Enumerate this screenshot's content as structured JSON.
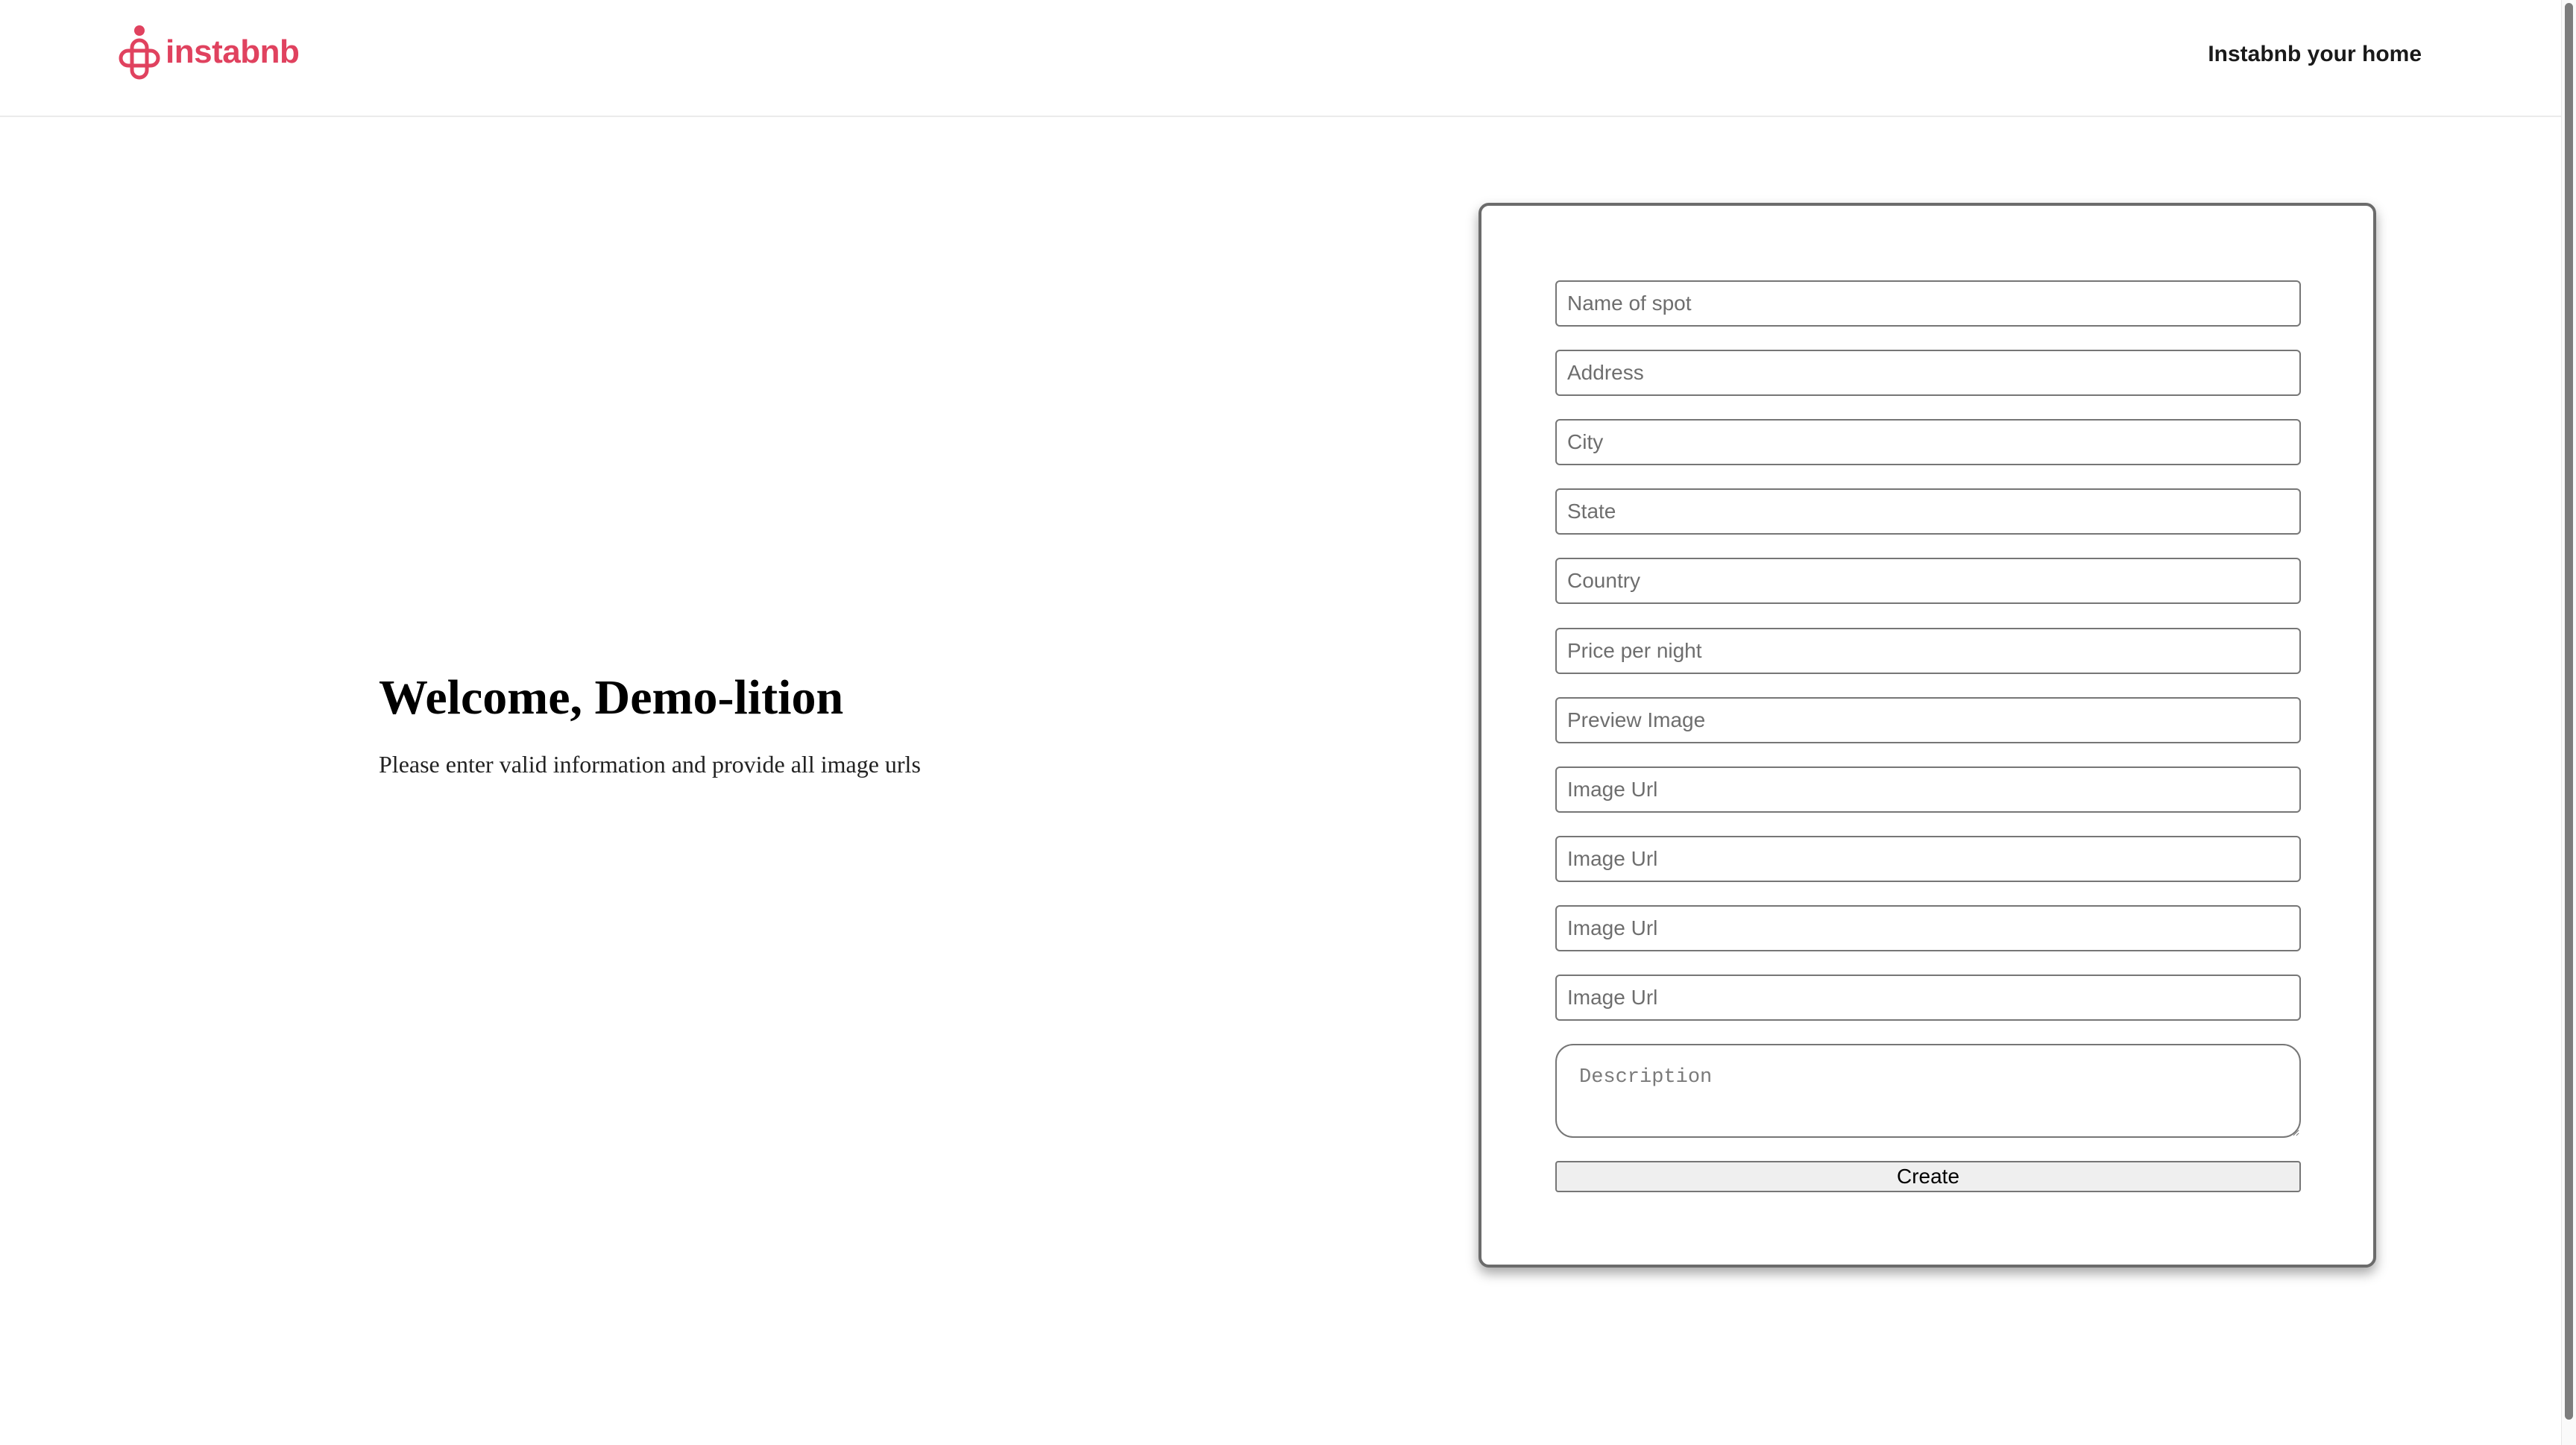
{
  "header": {
    "logo_text": "instabnb",
    "host_link": "Instabnb your home",
    "brand_color": "#e0425f"
  },
  "welcome": {
    "title": "Welcome, Demo-lition",
    "subtitle": "Please enter valid information and provide all image urls"
  },
  "form": {
    "fields": [
      {
        "placeholder": "Name of spot",
        "value": ""
      },
      {
        "placeholder": "Address",
        "value": ""
      },
      {
        "placeholder": "City",
        "value": ""
      },
      {
        "placeholder": "State",
        "value": ""
      },
      {
        "placeholder": "Country",
        "value": ""
      },
      {
        "placeholder": "Price per night",
        "value": ""
      },
      {
        "placeholder": "Preview Image",
        "value": ""
      },
      {
        "placeholder": "Image Url",
        "value": ""
      },
      {
        "placeholder": "Image Url",
        "value": ""
      },
      {
        "placeholder": "Image Url",
        "value": ""
      },
      {
        "placeholder": "Image Url",
        "value": ""
      }
    ],
    "description_placeholder": "Description",
    "submit_label": "Create"
  }
}
